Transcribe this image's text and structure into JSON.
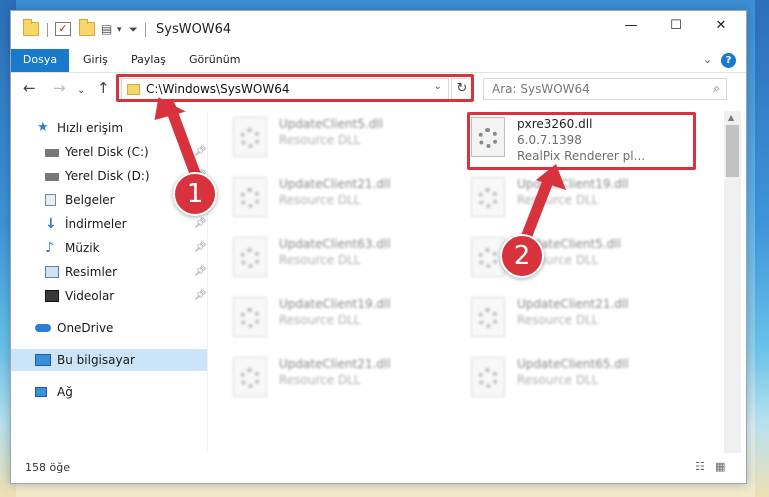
{
  "window": {
    "title": "SysWOW64"
  },
  "ribbon": {
    "tabs": [
      "Dosya",
      "Giriş",
      "Paylaş",
      "Görünüm"
    ]
  },
  "nav": {
    "address": "C:\\Windows\\SysWOW64",
    "search_placeholder": "Ara: SysWOW64"
  },
  "sidebar": {
    "items": [
      {
        "label": "Hızlı erişim",
        "icon": "star-icon"
      },
      {
        "label": "Yerel Disk (C:)",
        "icon": "drive-icon",
        "pinned": true
      },
      {
        "label": "Yerel Disk (D:)",
        "icon": "drive-icon",
        "pinned": true
      },
      {
        "label": "Belgeler",
        "icon": "documents-icon",
        "pinned": true
      },
      {
        "label": "İndirmeler",
        "icon": "download-icon",
        "pinned": true
      },
      {
        "label": "Müzik",
        "icon": "music-icon",
        "pinned": true
      },
      {
        "label": "Resimler",
        "icon": "pictures-icon",
        "pinned": true
      },
      {
        "label": "Videolar",
        "icon": "video-icon",
        "pinned": true
      },
      {
        "label": "OneDrive",
        "icon": "cloud-icon"
      },
      {
        "label": "Bu bilgisayar",
        "icon": "computer-icon",
        "selected": true
      },
      {
        "label": "Ağ",
        "icon": "network-icon"
      }
    ]
  },
  "files": [
    {
      "name": "UpdateClient5.dll",
      "line2": "Resource DLL",
      "line3": ""
    },
    {
      "name": "pxre3260.dll",
      "line2": "6.0.7.1398",
      "line3": "RealPix Renderer pl...",
      "highlighted": true
    },
    {
      "name": "UpdateClient21.dll",
      "line2": "Resource DLL",
      "line3": ""
    },
    {
      "name": "UpdateClient19.dll",
      "line2": "Resource DLL",
      "line3": ""
    },
    {
      "name": "UpdateClient63.dll",
      "line2": "Resource DLL",
      "line3": ""
    },
    {
      "name": "UpdateClient5.dll",
      "line2": "Resource DLL",
      "line3": ""
    },
    {
      "name": "UpdateClient19.dll",
      "line2": "Resource DLL",
      "line3": ""
    },
    {
      "name": "UpdateClient21.dll",
      "line2": "Resource DLL",
      "line3": ""
    },
    {
      "name": "UpdateClient21.dll",
      "line2": "Resource DLL",
      "line3": ""
    },
    {
      "name": "UpdateClient65.dll",
      "line2": "Resource DLL",
      "line3": ""
    }
  ],
  "status": {
    "item_count": "158 öğe"
  },
  "annotations": {
    "step1": "1",
    "step2": "2",
    "color": "#d8323c"
  },
  "win_buttons": {
    "minimize": "—",
    "maximize": "☐",
    "close": "✕"
  }
}
